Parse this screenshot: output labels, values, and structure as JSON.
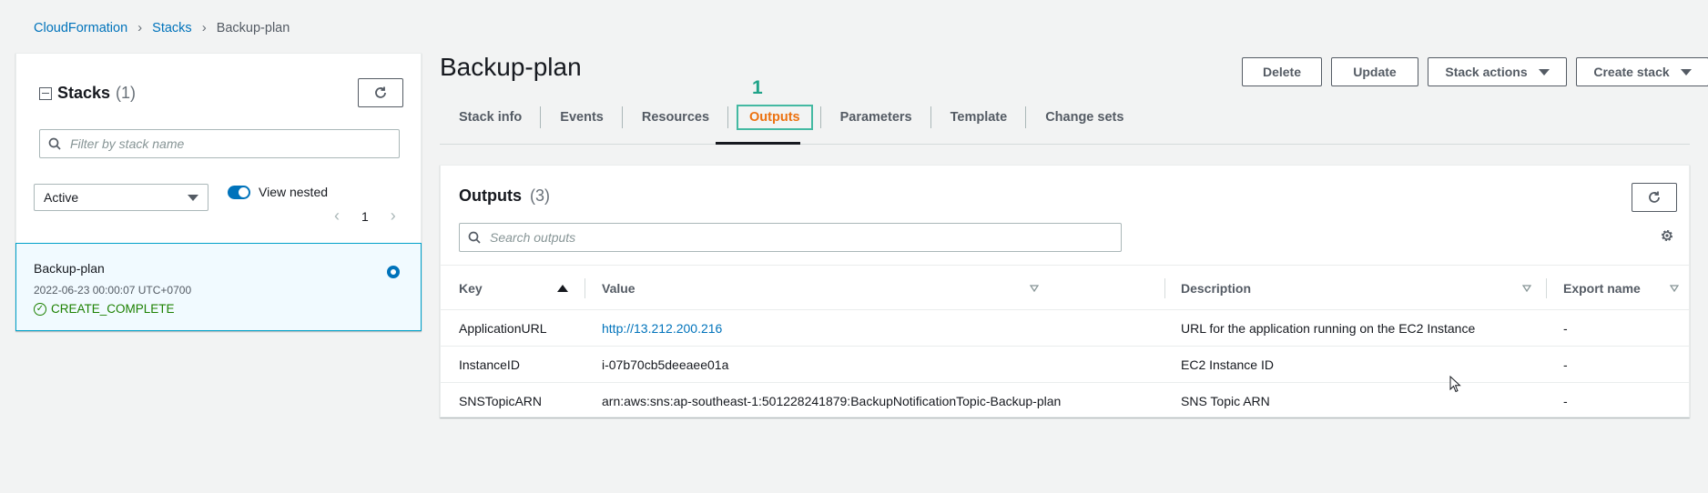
{
  "breadcrumb": {
    "items": [
      "CloudFormation",
      "Stacks"
    ],
    "current": "Backup-plan"
  },
  "left_panel": {
    "title": "Stacks",
    "count": "(1)",
    "search_placeholder": "Filter by stack name",
    "filter_select": "Active",
    "toggle_label": "View nested",
    "toggle_on": true,
    "page": "1",
    "stack": {
      "name": "Backup-plan",
      "date": "2022-06-23 00:00:07 UTC+0700",
      "status": "CREATE_COMPLETE",
      "selected": true
    }
  },
  "main": {
    "title": "Backup-plan",
    "actions": {
      "delete": "Delete",
      "update": "Update",
      "stack_actions": "Stack actions",
      "create_stack": "Create stack"
    },
    "annotation": "1",
    "tabs": [
      "Stack info",
      "Events",
      "Resources",
      "Outputs",
      "Parameters",
      "Template",
      "Change sets"
    ],
    "active_tab": "Outputs"
  },
  "outputs": {
    "title": "Outputs",
    "count": "(3)",
    "search_placeholder": "Search outputs",
    "columns": {
      "key": "Key",
      "value": "Value",
      "description": "Description",
      "export": "Export name"
    },
    "rows": [
      {
        "key": "ApplicationURL",
        "value": "http://13.212.200.216",
        "description": "URL for the application running on the EC2 Instance",
        "export": "-"
      },
      {
        "key": "InstanceID",
        "value": "i-07b70cb5deeaee01a",
        "description": "EC2 Instance ID",
        "export": "-"
      },
      {
        "key": "SNSTopicARN",
        "value": "arn:aws:sns:ap-southeast-1:501228241879:BackupNotificationTopic-Backup-plan",
        "description": "SNS Topic ARN",
        "export": "-"
      }
    ]
  },
  "colors": {
    "link": "#0073bb",
    "active_tab": "#ec7211",
    "annotation": "#20a389",
    "success": "#1d8102"
  }
}
